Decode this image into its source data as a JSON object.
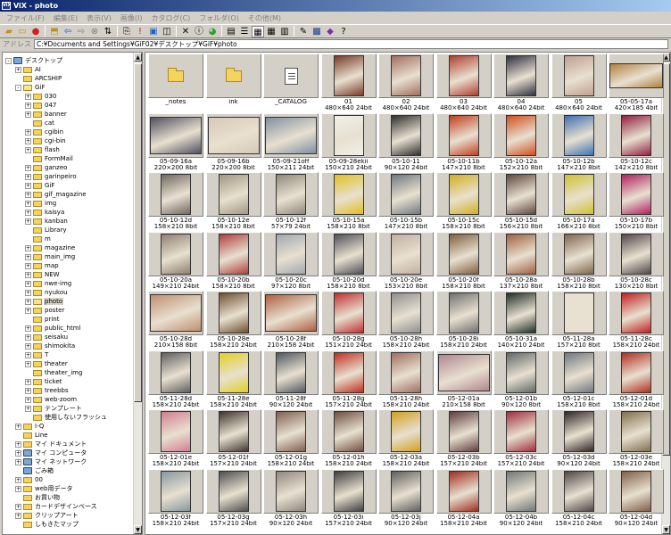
{
  "window": {
    "title": "ViX - photo",
    "app_icon": "ViX"
  },
  "menu": [
    "ファイル(F)",
    "編集(E)",
    "表示(V)",
    "画像(I)",
    "カタログ(C)",
    "フォルダ(O)",
    "その他(M)"
  ],
  "address": {
    "label": "アドレス",
    "value": "C:¥Documents and Settings¥GiF02¥デスクトップ¥GiF¥photo"
  },
  "tree": [
    {
      "label": "デスクトップ",
      "depth": 0,
      "exp": "-",
      "icon": "special"
    },
    {
      "label": "AI",
      "depth": 1,
      "exp": "+",
      "icon": "folder"
    },
    {
      "label": "ARCSHIP",
      "depth": 1,
      "exp": "",
      "icon": "folder"
    },
    {
      "label": "GiF",
      "depth": 1,
      "exp": "-",
      "icon": "folder-open"
    },
    {
      "label": "030",
      "depth": 2,
      "exp": "+",
      "icon": "folder"
    },
    {
      "label": "047",
      "depth": 2,
      "exp": "+",
      "icon": "folder"
    },
    {
      "label": "banner",
      "depth": 2,
      "exp": "+",
      "icon": "folder"
    },
    {
      "label": "cat",
      "depth": 2,
      "exp": "",
      "icon": "folder"
    },
    {
      "label": "cgibin",
      "depth": 2,
      "exp": "+",
      "icon": "folder"
    },
    {
      "label": "cgi-bin",
      "depth": 2,
      "exp": "+",
      "icon": "folder"
    },
    {
      "label": "flash",
      "depth": 2,
      "exp": "+",
      "icon": "folder"
    },
    {
      "label": "FormMail",
      "depth": 2,
      "exp": "",
      "icon": "folder"
    },
    {
      "label": "ganzeo",
      "depth": 2,
      "exp": "+",
      "icon": "folder"
    },
    {
      "label": "garinpeiro",
      "depth": 2,
      "exp": "+",
      "icon": "folder"
    },
    {
      "label": "GiF",
      "depth": 2,
      "exp": "+",
      "icon": "folder"
    },
    {
      "label": "gif_magazine",
      "depth": 2,
      "exp": "+",
      "icon": "folder"
    },
    {
      "label": "img",
      "depth": 2,
      "exp": "+",
      "icon": "folder"
    },
    {
      "label": "kaisya",
      "depth": 2,
      "exp": "+",
      "icon": "folder"
    },
    {
      "label": "kanban",
      "depth": 2,
      "exp": "+",
      "icon": "folder"
    },
    {
      "label": "Library",
      "depth": 2,
      "exp": "",
      "icon": "folder"
    },
    {
      "label": "m",
      "depth": 2,
      "exp": "",
      "icon": "folder"
    },
    {
      "label": "magazine",
      "depth": 2,
      "exp": "+",
      "icon": "folder"
    },
    {
      "label": "main_img",
      "depth": 2,
      "exp": "+",
      "icon": "folder"
    },
    {
      "label": "map",
      "depth": 2,
      "exp": "+",
      "icon": "folder"
    },
    {
      "label": "NEW",
      "depth": 2,
      "exp": "+",
      "icon": "folder"
    },
    {
      "label": "nwe-img",
      "depth": 2,
      "exp": "+",
      "icon": "folder"
    },
    {
      "label": "nyukou",
      "depth": 2,
      "exp": "+",
      "icon": "folder"
    },
    {
      "label": "photo",
      "depth": 2,
      "exp": "+",
      "icon": "folder-open",
      "selected": true
    },
    {
      "label": "poster",
      "depth": 2,
      "exp": "+",
      "icon": "folder"
    },
    {
      "label": "print",
      "depth": 2,
      "exp": "",
      "icon": "folder"
    },
    {
      "label": "public_html",
      "depth": 2,
      "exp": "+",
      "icon": "folder"
    },
    {
      "label": "seisaku",
      "depth": 2,
      "exp": "+",
      "icon": "folder"
    },
    {
      "label": "shimokita",
      "depth": 2,
      "exp": "+",
      "icon": "folder"
    },
    {
      "label": "T",
      "depth": 2,
      "exp": "+",
      "icon": "folder"
    },
    {
      "label": "theater",
      "depth": 2,
      "exp": "+",
      "icon": "folder"
    },
    {
      "label": "theater_img",
      "depth": 2,
      "exp": "",
      "icon": "folder"
    },
    {
      "label": "ticket",
      "depth": 2,
      "exp": "+",
      "icon": "folder"
    },
    {
      "label": "treebbs",
      "depth": 2,
      "exp": "+",
      "icon": "folder"
    },
    {
      "label": "web-zoom",
      "depth": 2,
      "exp": "+",
      "icon": "folder"
    },
    {
      "label": "テンプレート",
      "depth": 2,
      "exp": "+",
      "icon": "folder"
    },
    {
      "label": "使用しないフラッシュ",
      "depth": 2,
      "exp": "",
      "icon": "folder"
    },
    {
      "label": "I-Q",
      "depth": 1,
      "exp": "+",
      "icon": "folder"
    },
    {
      "label": "Line",
      "depth": 1,
      "exp": "",
      "icon": "folder"
    },
    {
      "label": "マイ ドキュメント",
      "depth": 1,
      "exp": "+",
      "icon": "folder"
    },
    {
      "label": "マイ コンピュータ",
      "depth": 1,
      "exp": "+",
      "icon": "special"
    },
    {
      "label": "マイ ネットワーク",
      "depth": 1,
      "exp": "+",
      "icon": "special"
    },
    {
      "label": "ごみ箱",
      "depth": 1,
      "exp": "",
      "icon": "special"
    },
    {
      "label": "00",
      "depth": 1,
      "exp": "+",
      "icon": "folder"
    },
    {
      "label": "web用データ",
      "depth": 1,
      "exp": "+",
      "icon": "folder"
    },
    {
      "label": "お買い物",
      "depth": 1,
      "exp": "",
      "icon": "folder"
    },
    {
      "label": "カードデザインベース",
      "depth": 1,
      "exp": "+",
      "icon": "folder"
    },
    {
      "label": "クリップアート",
      "depth": 1,
      "exp": "+",
      "icon": "folder"
    },
    {
      "label": "しもきたマップ",
      "depth": 1,
      "exp": "",
      "icon": "folder"
    }
  ],
  "items": [
    {
      "name": "_notes",
      "info": "",
      "kind": "folder"
    },
    {
      "name": "ink",
      "info": "",
      "kind": "folder"
    },
    {
      "name": "_CATALOG",
      "info": "",
      "kind": "doc"
    },
    {
      "name": "01",
      "info": "480×640 24bit",
      "kind": "photo",
      "color": "#7a3a2a",
      "o": "p"
    },
    {
      "name": "02",
      "info": "480×640 24bit",
      "kind": "photo",
      "color": "#a07060",
      "o": "p"
    },
    {
      "name": "03",
      "info": "480×640 24bit",
      "kind": "photo",
      "color": "#b04030",
      "o": "p"
    },
    {
      "name": "04",
      "info": "480×640 24bit",
      "kind": "photo",
      "color": "#303040",
      "o": "p"
    },
    {
      "name": "05",
      "info": "480×640 24bit",
      "kind": "photo",
      "color": "#c0a090",
      "o": "p"
    },
    {
      "name": "05-05-17a",
      "info": "420×185 4bit",
      "kind": "photo",
      "color": "#b08040",
      "o": "w"
    },
    {
      "name": "05-09-16a",
      "info": "220×200 8bit",
      "kind": "photo",
      "color": "#505060",
      "o": "l"
    },
    {
      "name": "05-09-16b",
      "info": "220×200 8bit",
      "kind": "photo",
      "color": "#d8c8b8",
      "o": "l"
    },
    {
      "name": "05-09-21off",
      "info": "150×211 24bit",
      "kind": "photo",
      "color": "#8090a0",
      "o": "l"
    },
    {
      "name": "05-09-28ekii",
      "info": "150×210 24bit",
      "kind": "photo",
      "color": "#f0f0e8",
      "o": "p"
    },
    {
      "name": "05-10-11",
      "info": "90×120 24bit",
      "kind": "photo",
      "color": "#303030",
      "o": "p"
    },
    {
      "name": "05-10-11b",
      "info": "147×210 8bit",
      "kind": "photo",
      "color": "#c04020",
      "o": "p"
    },
    {
      "name": "05-10-12a",
      "info": "152×210 8bit",
      "kind": "photo",
      "color": "#d05020",
      "o": "p"
    },
    {
      "name": "05-10-12b",
      "info": "147×210 8bit",
      "kind": "photo",
      "color": "#4070b0",
      "o": "p"
    },
    {
      "name": "05-10-12c",
      "info": "142×210 8bit",
      "kind": "photo",
      "color": "#902040",
      "o": "p"
    },
    {
      "name": "05-10-12d",
      "info": "158×210 8bit",
      "kind": "photo",
      "color": "#706860",
      "o": "p"
    },
    {
      "name": "05-10-12e",
      "info": "158×210 8bit",
      "kind": "photo",
      "color": "#a09880",
      "o": "p"
    },
    {
      "name": "05-10-12f",
      "info": "57×79 24bit",
      "kind": "photo",
      "color": "#908878",
      "o": "p"
    },
    {
      "name": "05-10-15a",
      "info": "158×210 8bit",
      "kind": "photo",
      "color": "#e0c020",
      "o": "p"
    },
    {
      "name": "05-10-15b",
      "info": "147×210 8bit",
      "kind": "photo",
      "color": "#707880",
      "o": "p"
    },
    {
      "name": "05-10-15c",
      "info": "158×210 8bit",
      "kind": "photo",
      "color": "#d0b020",
      "o": "p"
    },
    {
      "name": "05-10-15d",
      "info": "156×210 8bit",
      "kind": "photo",
      "color": "#604840",
      "o": "p"
    },
    {
      "name": "05-10-17a",
      "info": "166×210 8bit",
      "kind": "photo",
      "color": "#d0c030",
      "o": "p"
    },
    {
      "name": "05-10-17b",
      "info": "150×210 8bit",
      "kind": "photo",
      "color": "#b02060",
      "o": "p"
    },
    {
      "name": "05-10-20a",
      "info": "149×210 24bit",
      "kind": "photo",
      "color": "#908070",
      "o": "p"
    },
    {
      "name": "05-10-20b",
      "info": "158×210 8bit",
      "kind": "photo",
      "color": "#b04040",
      "o": "p"
    },
    {
      "name": "05-10-20c",
      "info": "97×120 8bit",
      "kind": "photo",
      "color": "#a0a8b0",
      "o": "p"
    },
    {
      "name": "05-10-20d",
      "info": "158×210 8bit",
      "kind": "photo",
      "color": "#505058",
      "o": "p"
    },
    {
      "name": "05-10-20e",
      "info": "153×210 8bit",
      "kind": "photo",
      "color": "#c0b0a0",
      "o": "p"
    },
    {
      "name": "05-10-20f",
      "info": "158×210 8bit",
      "kind": "photo",
      "color": "#806040",
      "o": "p"
    },
    {
      "name": "05-10-28a",
      "info": "137×210 8bit",
      "kind": "photo",
      "color": "#a06040",
      "o": "p"
    },
    {
      "name": "05-10-28b",
      "info": "158×210 8bit",
      "kind": "photo",
      "color": "#806850",
      "o": "p"
    },
    {
      "name": "05-10-28c",
      "info": "130×210 8bit",
      "kind": "photo",
      "color": "#504848",
      "o": "p"
    },
    {
      "name": "05-10-28d",
      "info": "210×158 8bit",
      "kind": "photo",
      "color": "#c09070",
      "o": "l"
    },
    {
      "name": "05-10-28e",
      "info": "158×210 24bit",
      "kind": "photo",
      "color": "#705030",
      "o": "p"
    },
    {
      "name": "05-10-28f",
      "info": "210×158 24bit",
      "kind": "photo",
      "color": "#b06040",
      "o": "l"
    },
    {
      "name": "05-10-28g",
      "info": "151×210 24bit",
      "kind": "photo",
      "color": "#c03030",
      "o": "p"
    },
    {
      "name": "05-10-28h",
      "info": "158×210 24bit",
      "kind": "photo",
      "color": "#909090",
      "o": "p"
    },
    {
      "name": "05-10-28i",
      "info": "158×210 24bit",
      "kind": "photo",
      "color": "#707070",
      "o": "p"
    },
    {
      "name": "05-10-31a",
      "info": "140×210 24bit",
      "kind": "photo",
      "color": "#203028",
      "o": "p"
    },
    {
      "name": "05-11-28a",
      "info": "157×210 8bit",
      "kind": "photo",
      "color": "#e8e0d0",
      "o": "p"
    },
    {
      "name": "05-11-28c",
      "info": "158×210 24bit",
      "kind": "photo",
      "color": "#c02020",
      "o": "p"
    },
    {
      "name": "05-11-28d",
      "info": "158×210 24bit",
      "kind": "photo",
      "color": "#606060",
      "o": "p"
    },
    {
      "name": "05-11-28e",
      "info": "158×210 24bit",
      "kind": "photo",
      "color": "#e0d020",
      "o": "p"
    },
    {
      "name": "05-11-28f",
      "info": "90×120 24bit",
      "kind": "photo",
      "color": "#505860",
      "o": "p"
    },
    {
      "name": "05-11-28g",
      "info": "157×210 24bit",
      "kind": "photo",
      "color": "#c03020",
      "o": "p"
    },
    {
      "name": "05-11-28h",
      "info": "158×210 24bit",
      "kind": "photo",
      "color": "#a07060",
      "o": "p"
    },
    {
      "name": "05-12-01a",
      "info": "210×158 8bit",
      "kind": "photo",
      "color": "#b08890",
      "o": "l"
    },
    {
      "name": "05-12-01b",
      "info": "90×120 8bit",
      "kind": "photo",
      "color": "#606868",
      "o": "p"
    },
    {
      "name": "05-12-01c",
      "info": "158×210 8bit",
      "kind": "photo",
      "color": "#707880",
      "o": "p"
    },
    {
      "name": "05-12-01d",
      "info": "158×210 24bit",
      "kind": "photo",
      "color": "#b03020",
      "o": "p"
    },
    {
      "name": "05-12-01e",
      "info": "158×210 24bit",
      "kind": "photo",
      "color": "#d08090",
      "o": "p"
    },
    {
      "name": "05-12-01f",
      "info": "157×210 24bit",
      "kind": "photo",
      "color": "#403830",
      "o": "p"
    },
    {
      "name": "05-12-01g",
      "info": "158×210 24bit",
      "kind": "photo",
      "color": "#806050",
      "o": "p"
    },
    {
      "name": "05-12-01h",
      "info": "158×210 24bit",
      "kind": "photo",
      "color": "#705040",
      "o": "p"
    },
    {
      "name": "05-12-03a",
      "info": "158×210 24bit",
      "kind": "photo",
      "color": "#d0a020",
      "o": "p"
    },
    {
      "name": "05-12-03b",
      "info": "157×210 24bit",
      "kind": "photo",
      "color": "#604040",
      "o": "p"
    },
    {
      "name": "05-12-03c",
      "info": "157×210 24bit",
      "kind": "photo",
      "color": "#a03040",
      "o": "p"
    },
    {
      "name": "05-12-03d",
      "info": "90×120 24bit",
      "kind": "photo",
      "color": "#302828",
      "o": "p"
    },
    {
      "name": "05-12-03e",
      "info": "158×210 24bit",
      "kind": "photo",
      "color": "#807050",
      "o": "p"
    },
    {
      "name": "05-12-03f",
      "info": "158×210 24bit",
      "kind": "photo",
      "color": "#8898a0",
      "o": "p"
    },
    {
      "name": "05-12-03g",
      "info": "157×210 24bit",
      "kind": "photo",
      "color": "#505050",
      "o": "p"
    },
    {
      "name": "05-12-03h",
      "info": "90×120 24bit",
      "kind": "photo",
      "color": "#908880",
      "o": "p"
    },
    {
      "name": "05-12-03i",
      "info": "157×210 24bit",
      "kind": "photo",
      "color": "#404040",
      "o": "p"
    },
    {
      "name": "05-12-03j",
      "info": "90×120 24bit",
      "kind": "photo",
      "color": "#606060",
      "o": "p"
    },
    {
      "name": "05-12-04a",
      "info": "158×210 24bit",
      "kind": "photo",
      "color": "#a03020",
      "o": "p"
    },
    {
      "name": "05-12-04b",
      "info": "90×120 24bit",
      "kind": "photo",
      "color": "#707878",
      "o": "p"
    },
    {
      "name": "05-12-04c",
      "info": "158×210 24bit",
      "kind": "photo",
      "color": "#504848",
      "o": "p"
    },
    {
      "name": "05-12-04d",
      "info": "90×120 24bit",
      "kind": "photo",
      "color": "#806048",
      "o": "p"
    }
  ]
}
